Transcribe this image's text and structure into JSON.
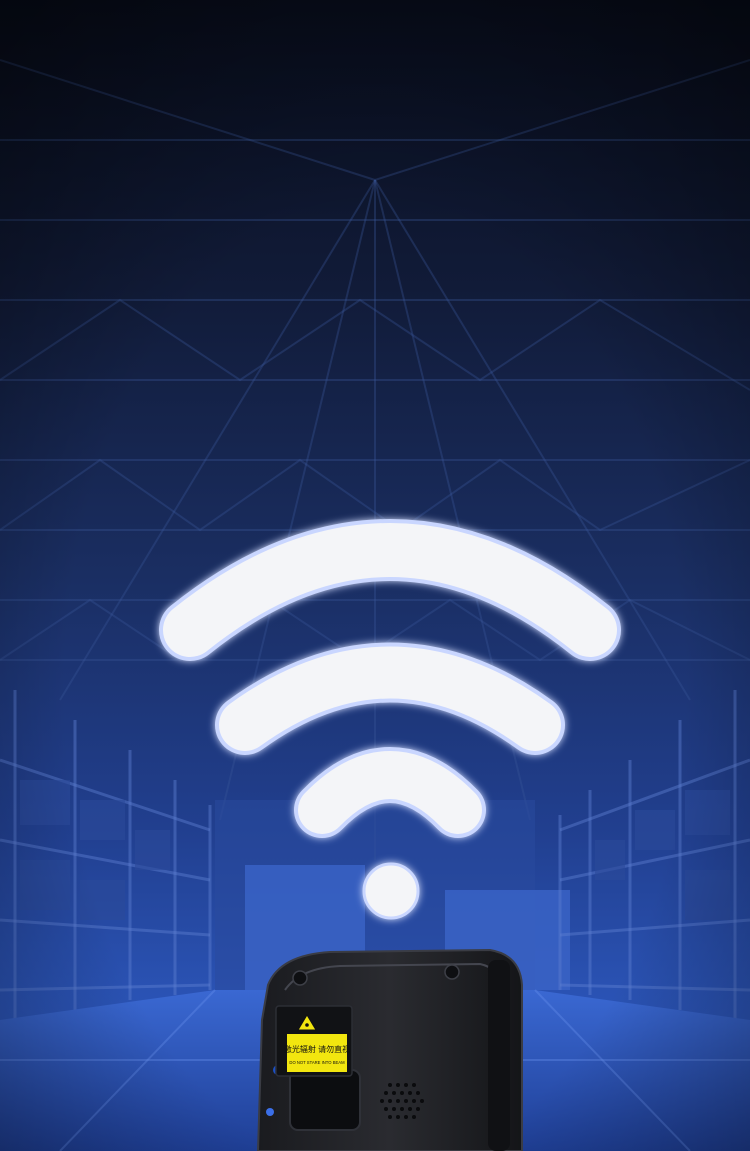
{
  "scene": {
    "description_colors": {
      "top": "#0a1022",
      "mid": "#1c3470",
      "floor": "#2a55b8",
      "accent": "#3d6fe0"
    }
  },
  "wifi": {
    "icon": "wifi-icon",
    "color": "#f4f5f8",
    "glow": "#7fa2ff"
  },
  "device": {
    "icon": "handheld-scanner-icon",
    "warning_icon": "laser-warning-icon",
    "label_line1": "激光辐射 请勿直视",
    "label_line2": "DO NOT STARE INTO BEAM",
    "label_color": "#f2e60f"
  }
}
